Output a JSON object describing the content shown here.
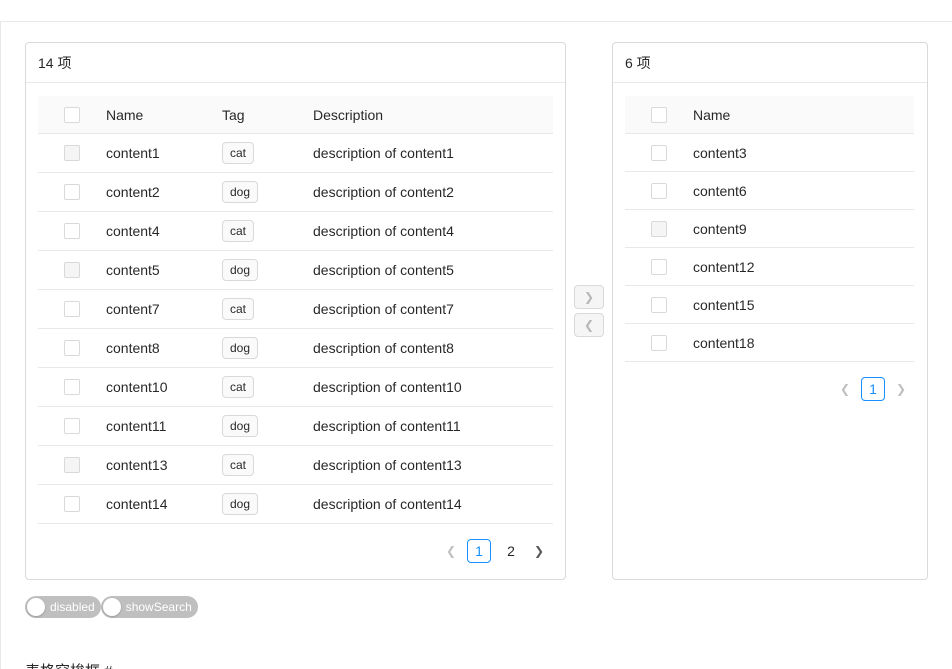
{
  "left": {
    "header": "14 项",
    "columns": [
      "Name",
      "Tag",
      "Description"
    ],
    "rows": [
      {
        "name": "content1",
        "tag": "cat",
        "desc": "description of content1",
        "disabled": true
      },
      {
        "name": "content2",
        "tag": "dog",
        "desc": "description of content2",
        "disabled": false
      },
      {
        "name": "content4",
        "tag": "cat",
        "desc": "description of content4",
        "disabled": false
      },
      {
        "name": "content5",
        "tag": "dog",
        "desc": "description of content5",
        "disabled": true
      },
      {
        "name": "content7",
        "tag": "cat",
        "desc": "description of content7",
        "disabled": false
      },
      {
        "name": "content8",
        "tag": "dog",
        "desc": "description of content8",
        "disabled": false
      },
      {
        "name": "content10",
        "tag": "cat",
        "desc": "description of content10",
        "disabled": false
      },
      {
        "name": "content11",
        "tag": "dog",
        "desc": "description of content11",
        "disabled": false
      },
      {
        "name": "content13",
        "tag": "cat",
        "desc": "description of content13",
        "disabled": true
      },
      {
        "name": "content14",
        "tag": "dog",
        "desc": "description of content14",
        "disabled": false
      }
    ],
    "pagination": {
      "pages": [
        "1",
        "2"
      ],
      "current": "1"
    }
  },
  "right": {
    "header": "6 项",
    "columns": [
      "Name"
    ],
    "rows": [
      {
        "name": "content3",
        "disabled": false
      },
      {
        "name": "content6",
        "disabled": false
      },
      {
        "name": "content9",
        "disabled": true
      },
      {
        "name": "content12",
        "disabled": false
      },
      {
        "name": "content15",
        "disabled": false
      },
      {
        "name": "content18",
        "disabled": false
      }
    ],
    "pagination": {
      "pages": [
        "1"
      ],
      "current": "1"
    }
  },
  "operations": {
    "to_right_icon": "chevron-right-icon",
    "to_left_icon": "chevron-left-icon"
  },
  "switches": {
    "disabled_label": "disabled",
    "show_search_label": "showSearch"
  },
  "section_title": "表格穿梭框 #",
  "colors": {
    "accent": "#1890ff",
    "switch_off": "#bfbfbf",
    "border": "#d9d9d9"
  }
}
